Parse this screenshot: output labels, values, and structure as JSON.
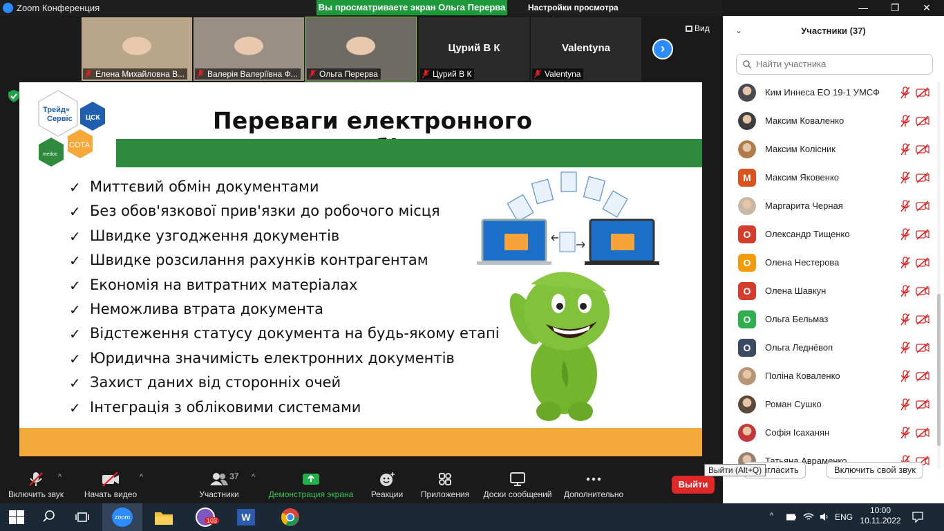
{
  "window": {
    "app_title": "Zoom Конференция",
    "share_banner": "Вы просматриваете экран Ольга Перерва",
    "view_options": "Настройки просмотра",
    "view_options_caret": "⌄",
    "minimize": "—",
    "restore": "❐",
    "close": "✕"
  },
  "thumbnails": [
    {
      "label": "Елена Михайловна В...",
      "big_name": "",
      "has_video": true,
      "video_color": "#b9a58a"
    },
    {
      "label": "Валерія Валеріївна Ф...",
      "big_name": "",
      "has_video": true,
      "video_color": "#9a8f84"
    },
    {
      "label": "Ольга Перерва",
      "big_name": "",
      "has_video": true,
      "video_color": "#6e6a64"
    },
    {
      "label": "Цурий В К",
      "big_name": "Цурий В К",
      "has_video": false,
      "video_color": "#2a2a2a"
    },
    {
      "label": "Valentyna",
      "big_name": "Valentyna",
      "has_video": false,
      "video_color": "#2a2a2a"
    }
  ],
  "thumb_controls": {
    "next": "›",
    "view": "Вид"
  },
  "slide": {
    "title": "Переваги електронного документообігу",
    "bullets": [
      "Миттєвий обмін документами",
      "Без обов'язкової прив'язки до робочого місця",
      "Швидке узгодження документів",
      "Швидке розсилання рахунків контрагентам",
      "Економія на витратних матеріалах",
      "Неможлива втрата документа",
      "Відстеження статусу документа на будь-якому етапі",
      "Юридична значимість електронних документів",
      "Захист даних від сторонніх очей",
      "Інтеграція з обліковими системами"
    ],
    "check_glyph": "✓",
    "logos": {
      "trade": "Трейд», Сервіс",
      "csk": "ЦСК",
      "sota": "СОТА",
      "medoc": "medoc"
    }
  },
  "toolbar": {
    "unmute": "Включить звук",
    "start_video": "Начать видео",
    "participants": "Участники",
    "participants_count": "37",
    "share": "Демонстрация экрана",
    "reactions": "Реакции",
    "apps": "Приложения",
    "whiteboard": "Доски сообщений",
    "more": "Дополнительно",
    "leave": "Выйти",
    "leave_tooltip": "Выйти (Alt+Q)",
    "caret": "^"
  },
  "panel": {
    "title": "Участники (37)",
    "collapse": "⌄",
    "search_placeholder": "Найти участника",
    "participants": [
      {
        "name": "Ким Иннеса ЕО 19-1 УМСФ",
        "initial": "",
        "color": "#4a4a52",
        "photo": true
      },
      {
        "name": "Максим Коваленко",
        "initial": "",
        "color": "#3d3d3d",
        "photo": true
      },
      {
        "name": "Максим Колісник",
        "initial": "",
        "color": "#b07a4a",
        "photo": true
      },
      {
        "name": "Максим Яковенко",
        "initial": "M",
        "color": "#d9531e",
        "photo": false
      },
      {
        "name": "Маргарита Черная",
        "initial": "",
        "color": "#c9b8a6",
        "photo": true
      },
      {
        "name": "Олександр Тищенко",
        "initial": "O",
        "color": "#d33d2e",
        "photo": false
      },
      {
        "name": "Олена Нестерова",
        "initial": "O",
        "color": "#f29b0c",
        "photo": false
      },
      {
        "name": "Олена Шавкун",
        "initial": "O",
        "color": "#d33d2e",
        "photo": false
      },
      {
        "name": "Ольга Бельмаз",
        "initial": "O",
        "color": "#2fae4e",
        "photo": false
      },
      {
        "name": "Ольга Леднёвоп",
        "initial": "O",
        "color": "#3a4a63",
        "photo": false
      },
      {
        "name": "Поліна Коваленко",
        "initial": "",
        "color": "#b79579",
        "photo": true
      },
      {
        "name": "Роман Сушко",
        "initial": "",
        "color": "#5b4a3c",
        "photo": true
      },
      {
        "name": "Софія Ісаханян",
        "initial": "",
        "color": "#c4373a",
        "photo": true
      },
      {
        "name": "Татьяна Авраменко",
        "initial": "",
        "color": "#9a8270",
        "photo": true
      }
    ],
    "invite": "Пригласить",
    "unmute_self": "Включить свой звук"
  },
  "taskbar": {
    "lang": "ENG",
    "time": "10:00",
    "date": "10.11.2022",
    "viber_badge": "103",
    "zoom_label": "zoom"
  },
  "colors": {
    "zoom_blue": "#2d8cff",
    "share_green": "#1d9a3a",
    "leave_red": "#e02828",
    "slide_green": "#2e8b3e",
    "slide_orange": "#f4a93b",
    "muted_red": "#e02020"
  }
}
